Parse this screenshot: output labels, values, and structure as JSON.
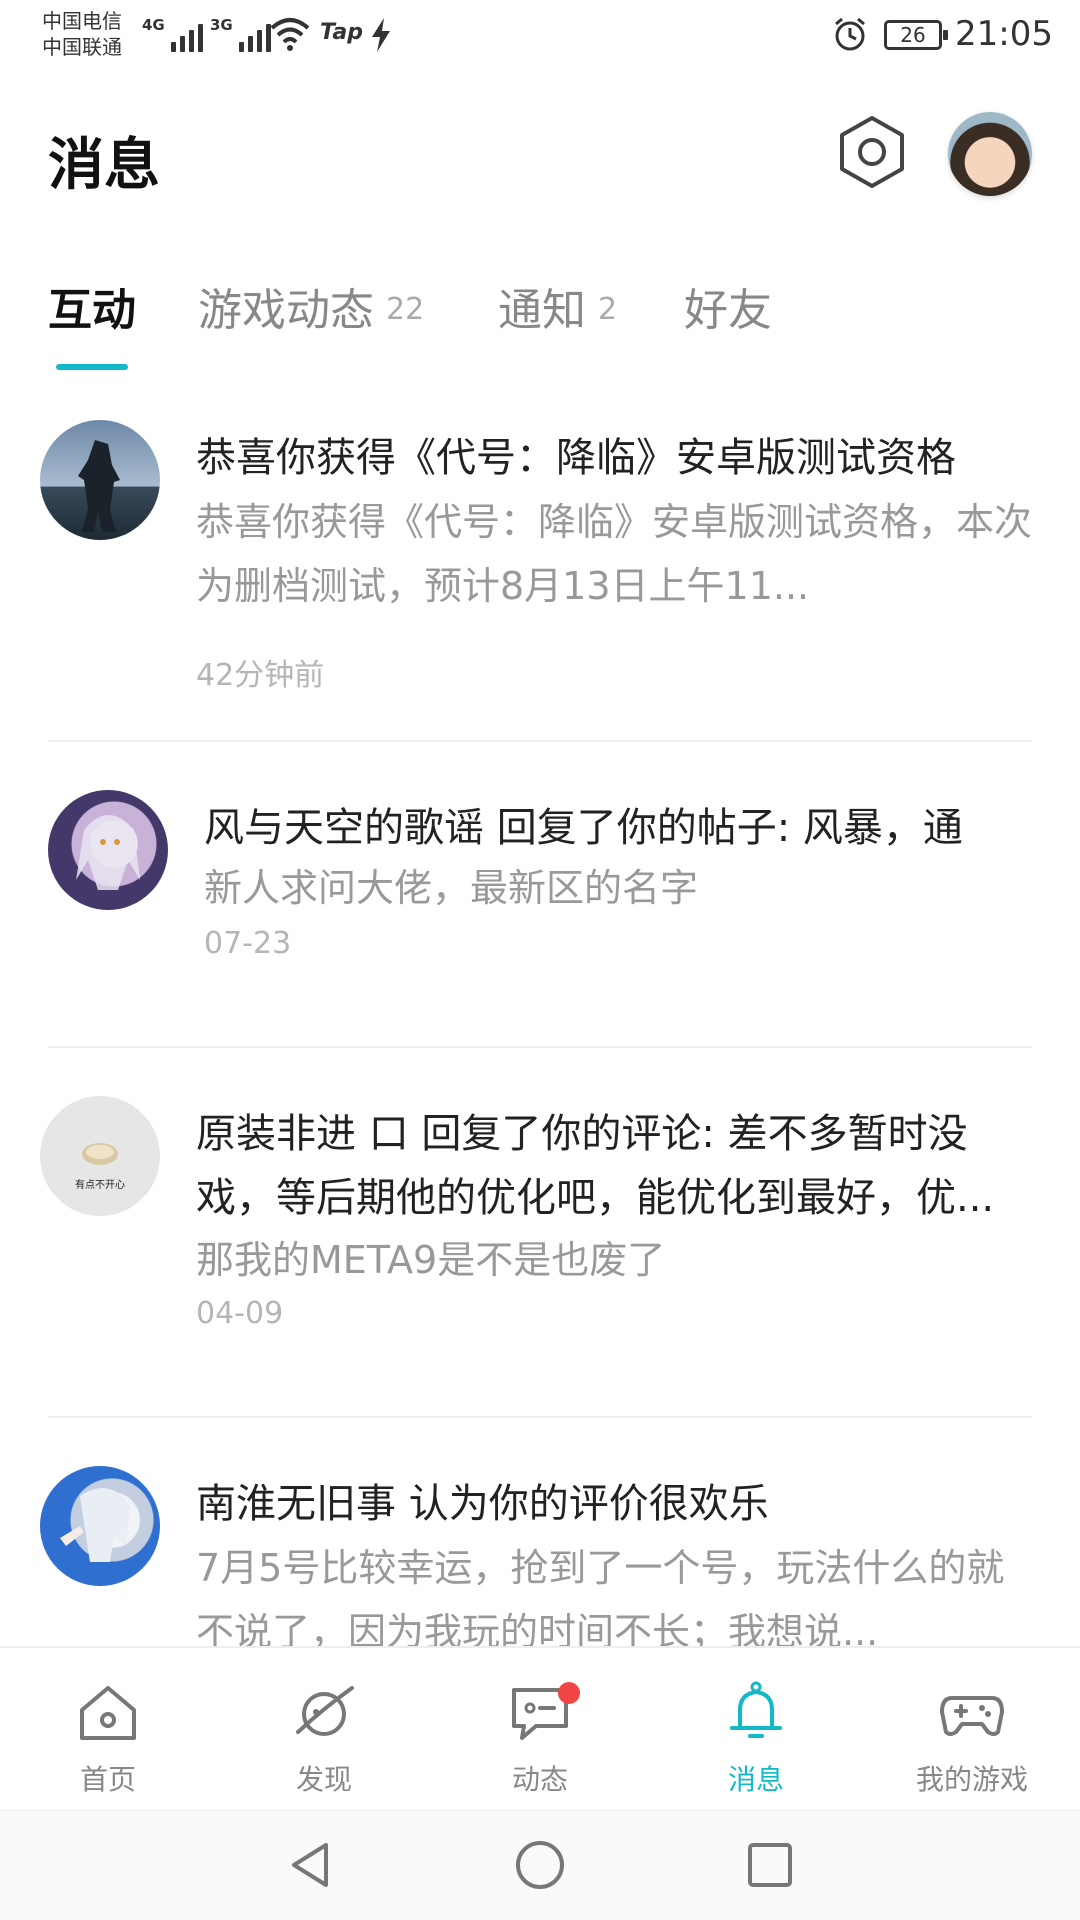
{
  "status_bar": {
    "carrier_1": "中国电信",
    "carrier_2": "中国联通",
    "net_1": "4G",
    "net_2": "3G",
    "tap_label": "Tap",
    "battery": "26",
    "time": "21:05"
  },
  "header": {
    "title": "消息",
    "settings_icon": "hexagon-settings-icon",
    "avatar_icon": "user-avatar"
  },
  "tabs": [
    {
      "label": "互动",
      "count": "",
      "active": true
    },
    {
      "label": "游戏动态",
      "count": "22",
      "active": false
    },
    {
      "label": "通知",
      "count": "2",
      "active": false
    },
    {
      "label": "好友",
      "count": "",
      "active": false
    }
  ],
  "messages": [
    {
      "title": "恭喜你获得《代号：降临》安卓版测试资格",
      "body": "恭喜你获得《代号：降临》安卓版测试资格，本次为删档测试，预计8月13日上午11...",
      "time": "42分钟前"
    },
    {
      "title": "风与天空的歌谣 回复了你的帖子: 风暴，通",
      "body": "新人求问大佬，最新区的名字",
      "time": "07-23"
    },
    {
      "title": "原装非进 口 回复了你的评论: 差不多暂时没戏，等后期他的优化吧，能优化到最好，优...",
      "body": "那我的META9是不是也废了",
      "time": "04-09",
      "avatar_text": "有点不开心"
    },
    {
      "title": "南淮无旧事 认为你的评价很欢乐",
      "body": "7月5号比较幸运，抢到了一个号，玩法什么的就不说了，因为我玩的时间不长；我想说...",
      "time": ""
    }
  ],
  "bottom_nav": [
    {
      "label": "首页",
      "icon": "home-icon",
      "active": false
    },
    {
      "label": "发现",
      "icon": "planet-icon",
      "active": false
    },
    {
      "label": "动态",
      "icon": "chat-icon",
      "active": false,
      "badge": true
    },
    {
      "label": "消息",
      "icon": "bell-icon",
      "active": true
    },
    {
      "label": "我的游戏",
      "icon": "gamepad-icon",
      "active": false
    }
  ],
  "colors": {
    "accent": "#14b9c8",
    "badge": "#f04545",
    "text_primary": "#222222",
    "text_secondary": "#999999"
  }
}
